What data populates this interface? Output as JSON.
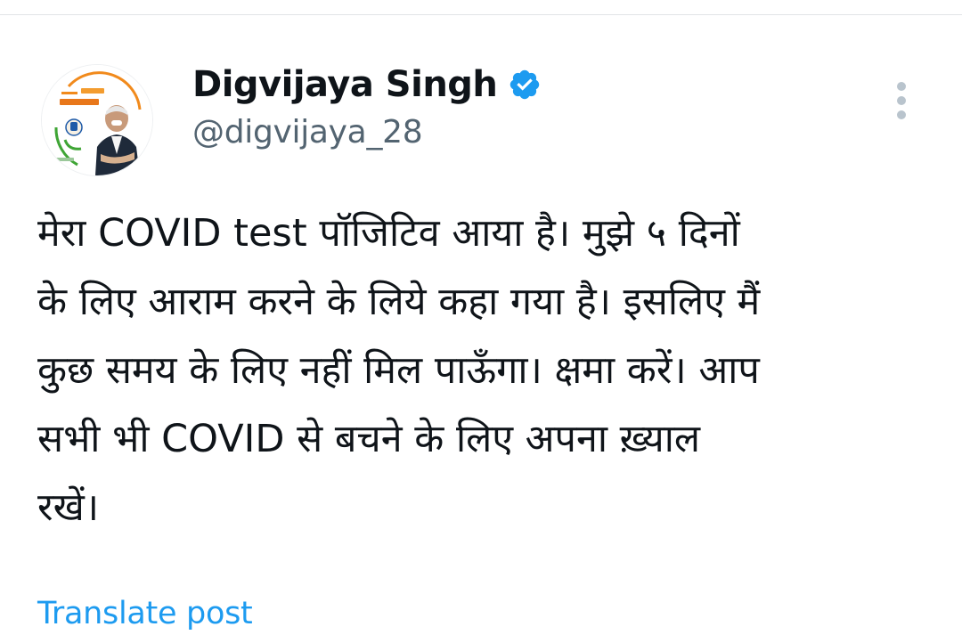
{
  "post": {
    "author": {
      "name": "Digvijaya Singh",
      "handle": "@digvijaya_28",
      "verified": true,
      "verified_icon": "verified-badge-icon"
    },
    "more_icon": "more-vertical-icon",
    "text_lines": [
      "मेरा COVID test पॉजिटिव आया है। मुझे ५ दिनों",
      "के लिए आराम करने के लिये कहा गया है। इसलिए मैं",
      "कुछ समय के लिए नहीं मिल पाऊँगा। क्षमा करें। आप",
      "सभी भी COVID से बचने के लिए अपना ख़्याल",
      "रखें।"
    ],
    "translate_label": "Translate post"
  },
  "colors": {
    "text_primary": "#0f1419",
    "text_secondary": "#536471",
    "link": "#1d9bf0",
    "verified": "#1d9bf0",
    "divider": "#e1e4e7",
    "icon_muted": "#b9c4cd"
  }
}
